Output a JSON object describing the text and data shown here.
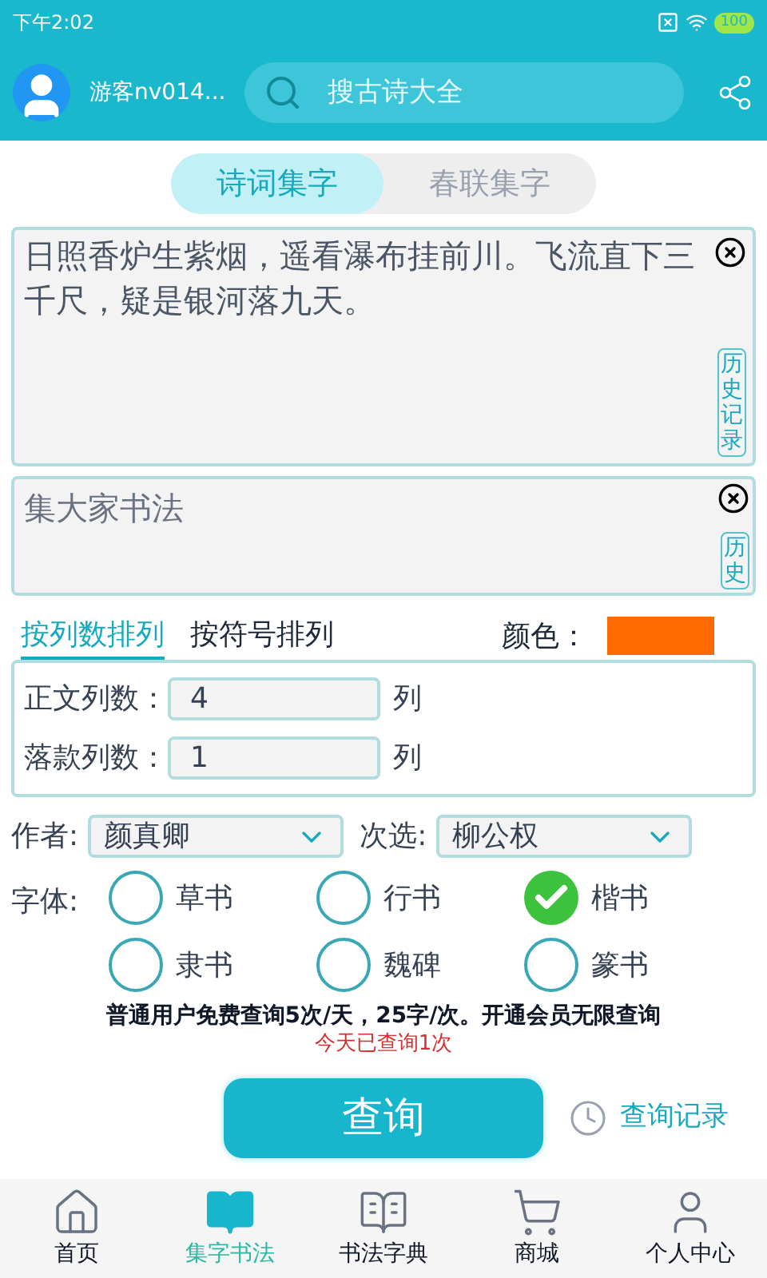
{
  "status_bar": {
    "time": "下午2:02",
    "battery": "100"
  },
  "header": {
    "username": "游客nv014...",
    "search": {
      "placeholder": "搜古诗大全"
    }
  },
  "mode_tabs": [
    {
      "label": "诗词集字",
      "selected": true
    },
    {
      "label": "春联集字",
      "selected": false
    }
  ],
  "poem_field": {
    "value": "日照香炉生紫烟，遥看瀑布挂前川。飞流直下三千尺，疑是银河落九天。",
    "history": "历史记录"
  },
  "title_field": {
    "placeholder": "集大家书法",
    "history": "历史"
  },
  "sort_tabs": [
    {
      "label": "按列数排列",
      "selected": true
    },
    {
      "label": "按符号排列",
      "selected": false
    }
  ],
  "color": {
    "label": "颜色：",
    "color": "#ff6a00"
  },
  "columns": [
    {
      "label": "正文列数：",
      "value": "4",
      "unit": "列"
    },
    {
      "label": "落款列数：",
      "value": "1",
      "unit": "列"
    }
  ],
  "author": {
    "label": "作者:",
    "value": "颜真卿"
  },
  "secondary": {
    "label": "次选:",
    "value": "柳公权"
  },
  "font_label": "字体:",
  "fonts": [
    {
      "label": "草书",
      "selected": false
    },
    {
      "label": "行书",
      "selected": false
    },
    {
      "label": "楷书",
      "selected": true
    },
    {
      "label": "隶书",
      "selected": false
    },
    {
      "label": "魏碑",
      "selected": false
    },
    {
      "label": "篆书",
      "selected": false
    }
  ],
  "notice": "普通用户免费查询5次/天，25字/次。开通会员无限查询",
  "today_count": "今天已查询1次",
  "query_button": "查询",
  "query_history": "查询记录",
  "nav": [
    {
      "kind": "home",
      "label": "首页",
      "selected": false
    },
    {
      "kind": "book",
      "label": "集字书法",
      "selected": true
    },
    {
      "kind": "dictionary",
      "label": "书法字典",
      "selected": false
    },
    {
      "kind": "cart",
      "label": "商城",
      "selected": false
    },
    {
      "kind": "person",
      "label": "个人中心",
      "selected": false
    }
  ]
}
